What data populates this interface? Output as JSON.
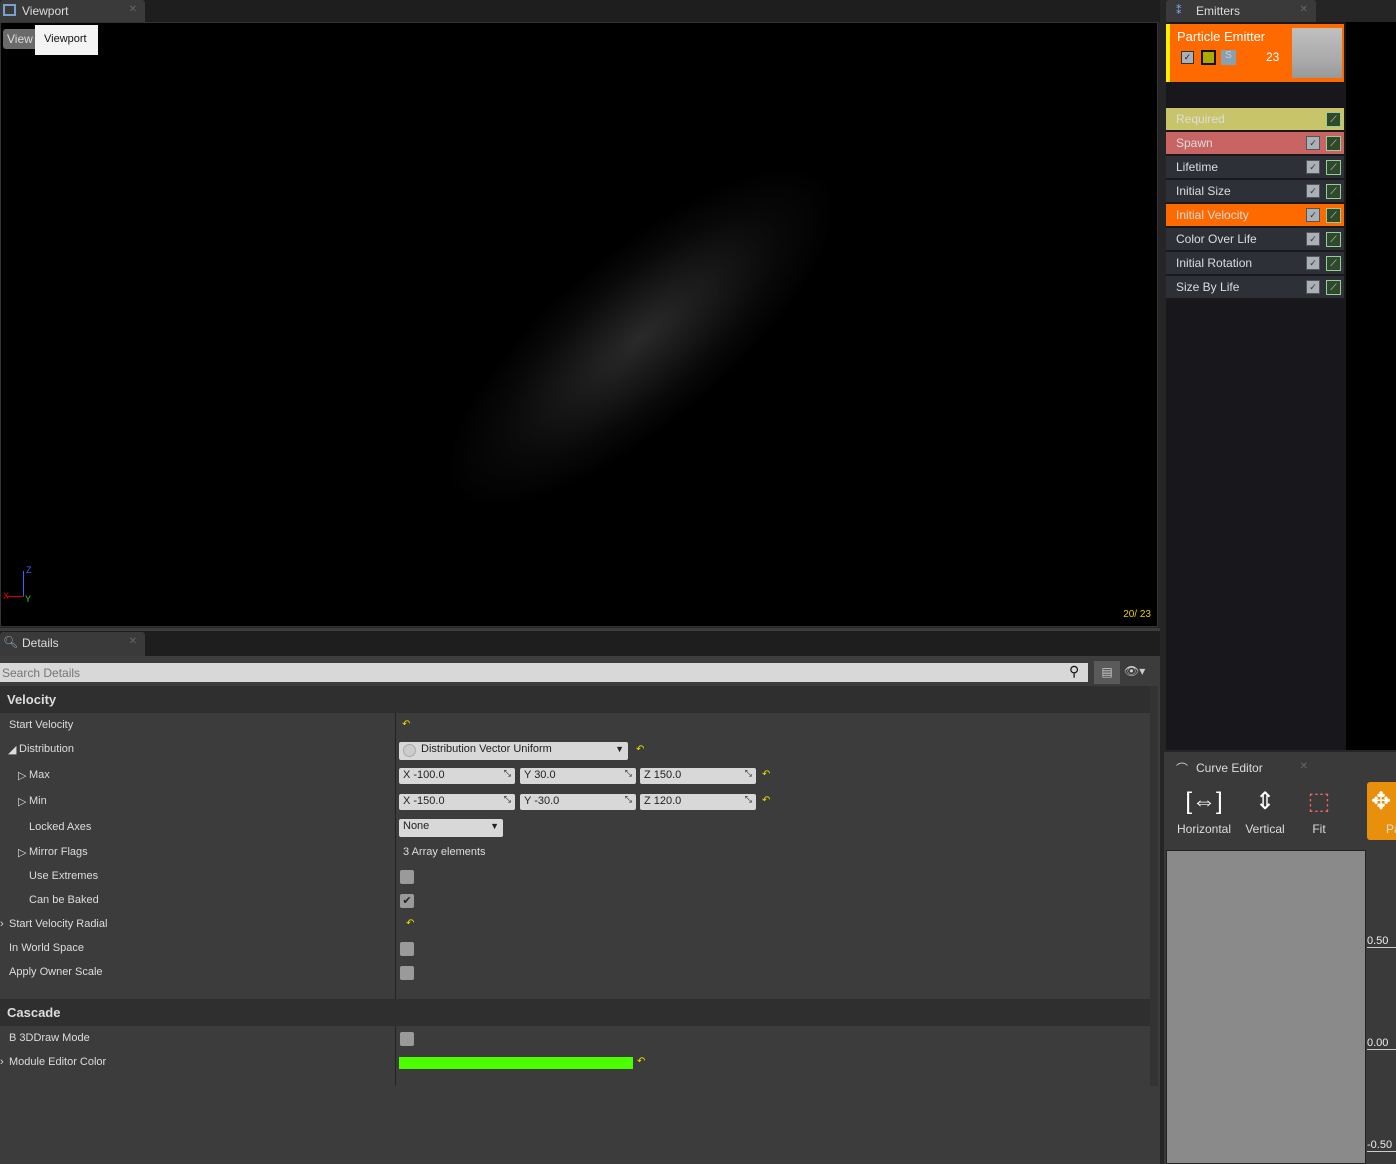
{
  "viewport": {
    "tab": "Viewport",
    "view_button": "View",
    "tooltip": "Viewport",
    "counter": "20/  23",
    "axes": {
      "z": "Z",
      "x": "X",
      "y": "Y"
    }
  },
  "emitters": {
    "tab": "Emitters",
    "emitter_name": "Particle Emitter",
    "count": "23",
    "solo": "S",
    "modules": [
      {
        "label": "Required",
        "color": "#c8c46a"
      },
      {
        "label": "Spawn",
        "color": "#c86464"
      },
      {
        "label": "Lifetime",
        "color": "#2e3038"
      },
      {
        "label": "Initial Size",
        "color": "#2e3038"
      },
      {
        "label": "Initial Velocity",
        "color": "#ff6a00"
      },
      {
        "label": "Color Over Life",
        "color": "#2e3038"
      },
      {
        "label": "Initial Rotation",
        "color": "#2e3038"
      },
      {
        "label": "Size By Life",
        "color": "#2e3038"
      }
    ]
  },
  "details": {
    "tab": "Details",
    "search_placeholder": "Search Details",
    "velocity": {
      "title": "Velocity",
      "start_velocity": "Start Velocity",
      "distribution": "Distribution",
      "distribution_value": "Distribution Vector Uniform",
      "max": "Max",
      "max_x": "X  -100.0",
      "max_y": "Y  30.0",
      "max_z": "Z  150.0",
      "min": "Min",
      "min_x": "X  -150.0",
      "min_y": "Y  -30.0",
      "min_z": "Z  120.0",
      "locked_axes": "Locked Axes",
      "locked_axes_value": "None",
      "mirror_flags": "Mirror Flags",
      "mirror_flags_value": "3 Array elements",
      "use_extremes": "Use Extremes",
      "can_be_baked": "Can be Baked",
      "start_velocity_radial": "Start Velocity Radial",
      "in_world_space": "In World Space",
      "apply_owner_scale": "Apply Owner Scale"
    },
    "cascade": {
      "title": "Cascade",
      "draw_mode": "B 3DDraw Mode",
      "module_editor_color": "Module Editor Color",
      "module_color": "#4cff00"
    },
    "checks": {
      "use_extremes": false,
      "can_be_baked": true,
      "in_world_space": false,
      "apply_owner_scale": false,
      "draw_mode": false
    }
  },
  "curve_editor": {
    "tab": "Curve Editor",
    "buttons": [
      "Horizontal",
      "Vertical",
      "Fit",
      "Pan"
    ],
    "ticks": [
      "0.50",
      "0.00",
      "-0.50"
    ]
  }
}
